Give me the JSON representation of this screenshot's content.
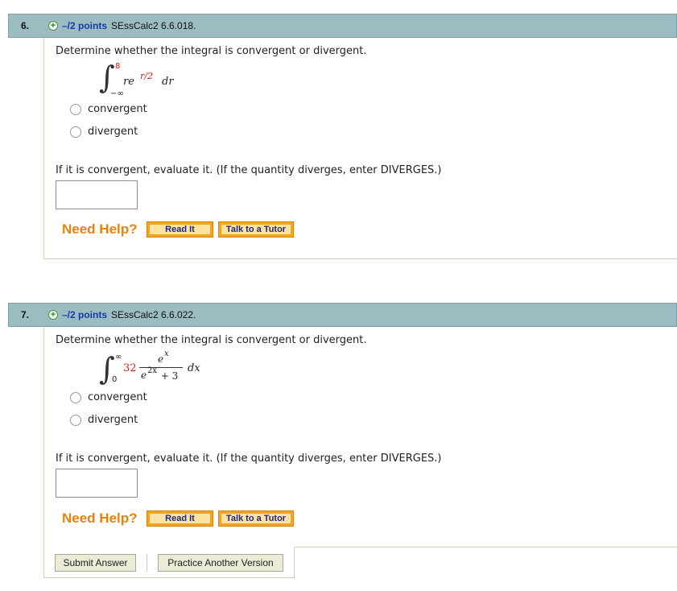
{
  "questions": [
    {
      "number": "6.",
      "points": "–/2 points",
      "id": "SEssCalc2 6.6.018.",
      "prompt": "Determine whether the integral is convergent or divergent.",
      "integral": {
        "upper": "8",
        "lower": "−∞",
        "integrand": "re",
        "exponent": "r/2",
        "differential": "dr"
      },
      "options": [
        "convergent",
        "divergent"
      ],
      "evaluate_prompt": "If it is convergent, evaluate it. (If the quantity diverges, enter DIVERGES.)",
      "answer_value": "",
      "need_help": "Need Help?",
      "read_it": "Read It",
      "talk_tutor": "Talk to a Tutor"
    },
    {
      "number": "7.",
      "points": "–/2 points",
      "id": "SEssCalc2 6.6.022.",
      "prompt": "Determine whether the integral is convergent or divergent.",
      "integral": {
        "upper": "∞",
        "lower": "0",
        "coefficient": "32",
        "numerator": "e",
        "numerator_exp": "x",
        "denominator_base": "e",
        "denominator_exp": "2x",
        "denominator_tail": " + 3",
        "differential": "dx"
      },
      "options": [
        "convergent",
        "divergent"
      ],
      "evaluate_prompt": "If it is convergent, evaluate it. (If the quantity diverges, enter DIVERGES.)",
      "answer_value": "",
      "need_help": "Need Help?",
      "read_it": "Read It",
      "talk_tutor": "Talk to a Tutor"
    }
  ],
  "footer": {
    "submit": "Submit Answer",
    "practice": "Practice Another Version"
  },
  "colors": {
    "header_bg": "#9bbcc1",
    "points_blue": "#1a3aa8",
    "need_help_orange": "#e8820c",
    "limit_red": "#d51a1a"
  }
}
